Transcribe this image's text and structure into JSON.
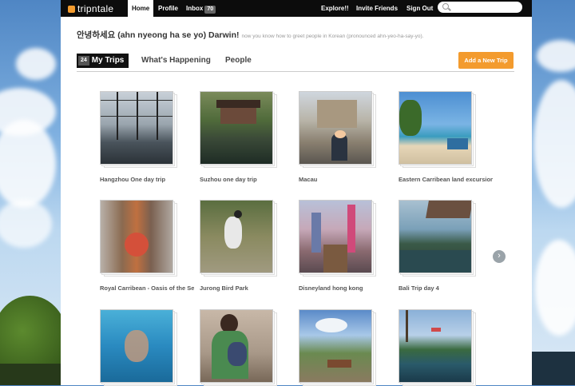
{
  "brand": "tripntale",
  "nav": [
    {
      "label": "Home",
      "badge": ""
    },
    {
      "label": "Profile",
      "badge": ""
    },
    {
      "label": "Inbox",
      "badge": "70"
    }
  ],
  "right_nav": [
    "Explore!!",
    "Invite Friends",
    "Sign Out"
  ],
  "search": {
    "placeholder": ""
  },
  "greeting": {
    "text": "안녕하세요 (ahn nyeong ha se yo) Darwin!",
    "sub": "now you know how to greet people in Korean (pronounced ahn-yeo-ha-say-yo)."
  },
  "tabs": [
    {
      "label": "My Trips",
      "count": "24"
    },
    {
      "label": "What's Happening",
      "count": ""
    },
    {
      "label": "People",
      "count": ""
    }
  ],
  "add_button": "Add a New Trip",
  "trips": [
    {
      "caption": "Hangzhou One day trip"
    },
    {
      "caption": "Suzhou one day trip"
    },
    {
      "caption": "Macau"
    },
    {
      "caption": "Eastern Carribean land excursions"
    },
    {
      "caption": "Royal Carribean - Oasis of the Seas"
    },
    {
      "caption": "Jurong Bird Park"
    },
    {
      "caption": "Disneyland hong kong"
    },
    {
      "caption": "Bali Trip day 4"
    },
    {
      "caption": ""
    },
    {
      "caption": ""
    },
    {
      "caption": ""
    },
    {
      "caption": ""
    }
  ],
  "next_arrow": "›",
  "colors": {
    "accent": "#f39b2e",
    "topbar": "#0c0c0c"
  }
}
